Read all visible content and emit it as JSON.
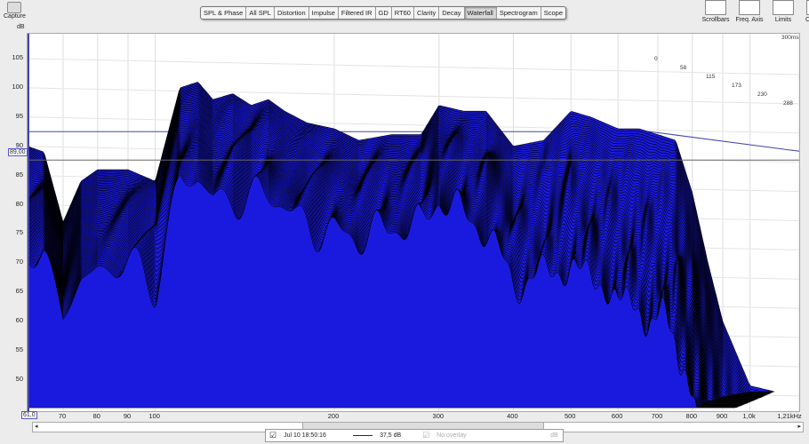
{
  "toolbar": {
    "capture": "Capture",
    "tabs": [
      "SPL & Phase",
      "All SPL",
      "Distortion",
      "Impulse",
      "Filtered IR",
      "GD",
      "RT60",
      "Clarity",
      "Decay",
      "Waterfall",
      "Spectrogram",
      "Scope"
    ],
    "active_tab": "Waterfall",
    "right_tools": [
      "Scrollbars",
      "Freq. Axis",
      "Limits",
      "Controls"
    ]
  },
  "cursor": {
    "level_readout": "89,00",
    "freq_readout": "61,0"
  },
  "legend": {
    "measurement": "Jul 10 18:50:16",
    "value": "37,5 dB",
    "overlay": "No overlay",
    "overlay_unit": "dB"
  },
  "chart_data": {
    "type": "waterfall",
    "title": "",
    "ylabel": "dB",
    "xlabel": "Hz",
    "ylim": [
      47,
      108
    ],
    "xlim": [
      61,
      1210
    ],
    "xscale": "log",
    "yticks": [
      105,
      100,
      95,
      90,
      85,
      80,
      75,
      70,
      65,
      60,
      55,
      50
    ],
    "xticks": [
      {
        "v": 70,
        "l": "70"
      },
      {
        "v": 80,
        "l": "80"
      },
      {
        "v": 90,
        "l": "90"
      },
      {
        "v": 100,
        "l": "100"
      },
      {
        "v": 200,
        "l": "200"
      },
      {
        "v": 300,
        "l": "300"
      },
      {
        "v": 400,
        "l": "400"
      },
      {
        "v": 500,
        "l": "500"
      },
      {
        "v": 600,
        "l": "600"
      },
      {
        "v": 700,
        "l": "700"
      },
      {
        "v": 800,
        "l": "800"
      },
      {
        "v": 900,
        "l": "900"
      },
      {
        "v": 1000,
        "l": "1,0k"
      },
      {
        "v": 1210,
        "l": "1,21kHz"
      }
    ],
    "time_labels": [
      "0",
      "58",
      "115",
      "173",
      "230",
      "288"
    ],
    "time_end": "300ms",
    "series_color": "#1a1adf",
    "envelope": {
      "freq": [
        61,
        65,
        70,
        75,
        80,
        90,
        100,
        110,
        118,
        125,
        135,
        145,
        155,
        165,
        180,
        200,
        220,
        250,
        280,
        300,
        330,
        360,
        400,
        450,
        500,
        540,
        600,
        650,
        700,
        750,
        800,
        850,
        900,
        1000,
        1100
      ],
      "db": [
        90,
        89,
        77,
        84,
        86,
        86,
        84,
        100,
        101,
        98,
        99,
        97,
        98,
        96,
        94,
        93,
        91,
        92,
        92,
        97,
        96,
        96,
        90,
        91,
        96,
        95,
        93,
        93,
        92,
        91,
        82,
        70,
        60,
        49,
        48
      ]
    },
    "cursor_level": 89,
    "reference_level": 92.5
  }
}
